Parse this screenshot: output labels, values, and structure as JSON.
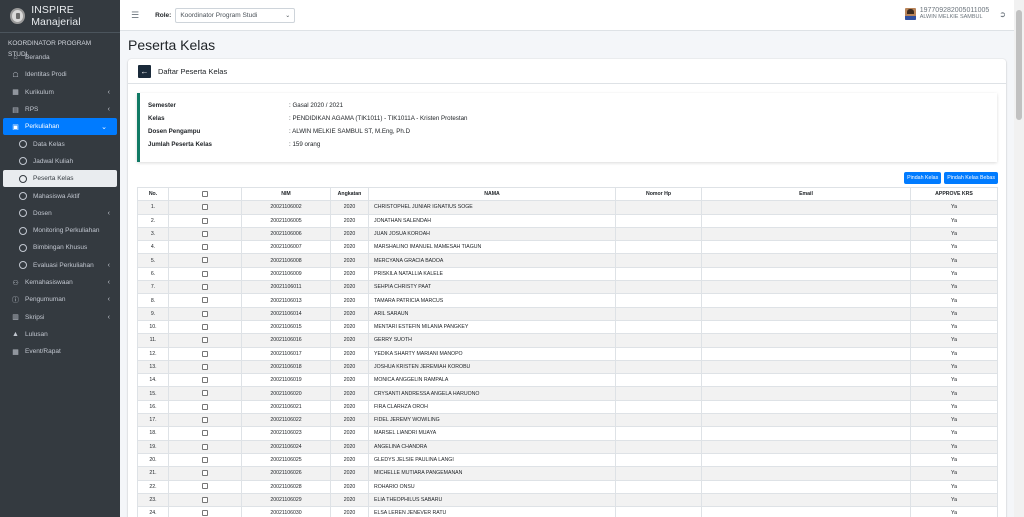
{
  "app": {
    "title": "INSPIRE Manajerial"
  },
  "sidebar": {
    "role_header": "KOORDINATOR PROGRAM STUDI",
    "items": [
      {
        "label": "Beranda",
        "icon": "home-icon",
        "has_chevron": false
      },
      {
        "label": "Identitas Prodi",
        "icon": "university-icon",
        "has_chevron": false
      },
      {
        "label": "Kurikulum",
        "icon": "table-icon",
        "has_chevron": true
      },
      {
        "label": "RPS",
        "icon": "file-icon",
        "has_chevron": true
      },
      {
        "label": "Perkuliahan",
        "icon": "briefcase-icon",
        "has_chevron": true,
        "active": true
      }
    ],
    "subitems": [
      {
        "label": "Data Kelas"
      },
      {
        "label": "Jadwal Kuliah"
      },
      {
        "label": "Peserta Kelas",
        "selected": true
      },
      {
        "label": "Mahasiswa Aktif"
      },
      {
        "label": "Dosen",
        "has_chevron": true
      },
      {
        "label": "Monitoring Perkuliahan"
      },
      {
        "label": "Bimbingan Khusus"
      },
      {
        "label": "Evaluasi Perkuliahan",
        "has_chevron": true
      }
    ],
    "items2": [
      {
        "label": "Kemahasiswaan",
        "icon": "users-icon",
        "has_chevron": true
      },
      {
        "label": "Pengumuman",
        "icon": "info-icon",
        "has_chevron": true
      },
      {
        "label": "Skripsi",
        "icon": "document-icon",
        "has_chevron": true
      },
      {
        "label": "Lulusan",
        "icon": "graduation-cap-icon",
        "has_chevron": false
      },
      {
        "label": "Event/Rapat",
        "icon": "calendar-icon",
        "has_chevron": false
      }
    ]
  },
  "topbar": {
    "role_label": "Role:",
    "role_value": "Koordinator Program Studi",
    "user_id": "197709282005011005",
    "user_name": "ALWIN MELKIE SAMBUL"
  },
  "page": {
    "title": "Peserta Kelas",
    "card_title": "Daftar Peserta Kelas"
  },
  "info": [
    {
      "key": "Semester",
      "value": ": Gasal 2020 / 2021"
    },
    {
      "key": "Kelas",
      "value": ": PENDIDIKAN AGAMA (TIK1011) - TIK1011A - Kristen Protestan"
    },
    {
      "key": "Dosen Pengampu",
      "value": ": ALWIN MELKIE SAMBUL ST, M.Eng, Ph.D"
    },
    {
      "key": "Jumlah Peserta Kelas",
      "value": ": 159 orang"
    }
  ],
  "buttons": {
    "pindah_kelas": "Pindah Kelas",
    "pindah_kelas_bebas": "Pindah Kelas Bebas"
  },
  "table": {
    "headers": [
      "No.",
      "",
      "NIM",
      "Angkatan",
      "NAMA",
      "Nomor Hp",
      "Email",
      "APPROVE KRS"
    ],
    "rows": [
      [
        "1.",
        "20021106002",
        "2020",
        "CHRISTOPHEL JUNIAR IGNATIUS SOGE",
        "",
        "",
        "Ya"
      ],
      [
        "2.",
        "20021106005",
        "2020",
        "JONATHAN SALENDAH",
        "",
        "",
        "Ya"
      ],
      [
        "3.",
        "20021106006",
        "2020",
        "JUAN JOSUA KOROAH",
        "",
        "",
        "Ya"
      ],
      [
        "4.",
        "20021106007",
        "2020",
        "MARSHALINO IMANUEL MAMESAH TIAGUN",
        "",
        "",
        "Ya"
      ],
      [
        "5.",
        "20021106008",
        "2020",
        "MERCYANA GRACIA BADOA",
        "",
        "",
        "Ya"
      ],
      [
        "6.",
        "20021106009",
        "2020",
        "PRISKILA NATALLIA KALELE",
        "",
        "",
        "Ya"
      ],
      [
        "7.",
        "20021106011",
        "2020",
        "SEHPIA CHRISTY PAAT",
        "",
        "",
        "Ya"
      ],
      [
        "8.",
        "20021106013",
        "2020",
        "TAMARA PATRICIA MARCUS",
        "",
        "",
        "Ya"
      ],
      [
        "9.",
        "20021106014",
        "2020",
        "ARIL SARAUN",
        "",
        "",
        "Ya"
      ],
      [
        "10.",
        "20021106015",
        "2020",
        "MENTARI ESTEFIN MILANIA PANGKEY",
        "",
        "",
        "Ya"
      ],
      [
        "11.",
        "20021106016",
        "2020",
        "GERRY SUOTH",
        "",
        "",
        "Ya"
      ],
      [
        "12.",
        "20021106017",
        "2020",
        "YEDIKA SHARTY MARIANI MANOPO",
        "",
        "",
        "Ya"
      ],
      [
        "13.",
        "20021106018",
        "2020",
        "JOSHUA KRISTEN JEREMIAH KOROBU",
        "",
        "",
        "Ya"
      ],
      [
        "14.",
        "20021106019",
        "2020",
        "MONICA ANGGELIN RAMPALA",
        "",
        "",
        "Ya"
      ],
      [
        "15.",
        "20021106020",
        "2020",
        "CRYSANTI ANDRESSA ANGELA HARUONO",
        "",
        "",
        "Ya"
      ],
      [
        "16.",
        "20021106021",
        "2020",
        "FIRA CLARHZA OROH",
        "",
        "",
        "Ya"
      ],
      [
        "17.",
        "20021106022",
        "2020",
        "FIDEL JEREMY WOWILING",
        "",
        "",
        "Ya"
      ],
      [
        "18.",
        "20021106023",
        "2020",
        "MARSEL LIANDRI MUAYA",
        "",
        "",
        "Ya"
      ],
      [
        "19.",
        "20021106024",
        "2020",
        "ANGELINA CHANDRA",
        "",
        "",
        "Ya"
      ],
      [
        "20.",
        "20021106025",
        "2020",
        "GLEDYS JELSIE PAULINA LANGI",
        "",
        "",
        "Ya"
      ],
      [
        "21.",
        "20021106026",
        "2020",
        "MICHELLE MUTIARA PANGEMANAN",
        "",
        "",
        "Ya"
      ],
      [
        "22.",
        "20021106028",
        "2020",
        "ROHARIO ONSU",
        "",
        "",
        "Ya"
      ],
      [
        "23.",
        "20021106029",
        "2020",
        "ELIA THEOPHILUS SABARU",
        "",
        "",
        "Ya"
      ],
      [
        "24.",
        "20021106030",
        "2020",
        "ELSA LEREN JENEVER RATU",
        "",
        "",
        "Ya"
      ]
    ]
  }
}
